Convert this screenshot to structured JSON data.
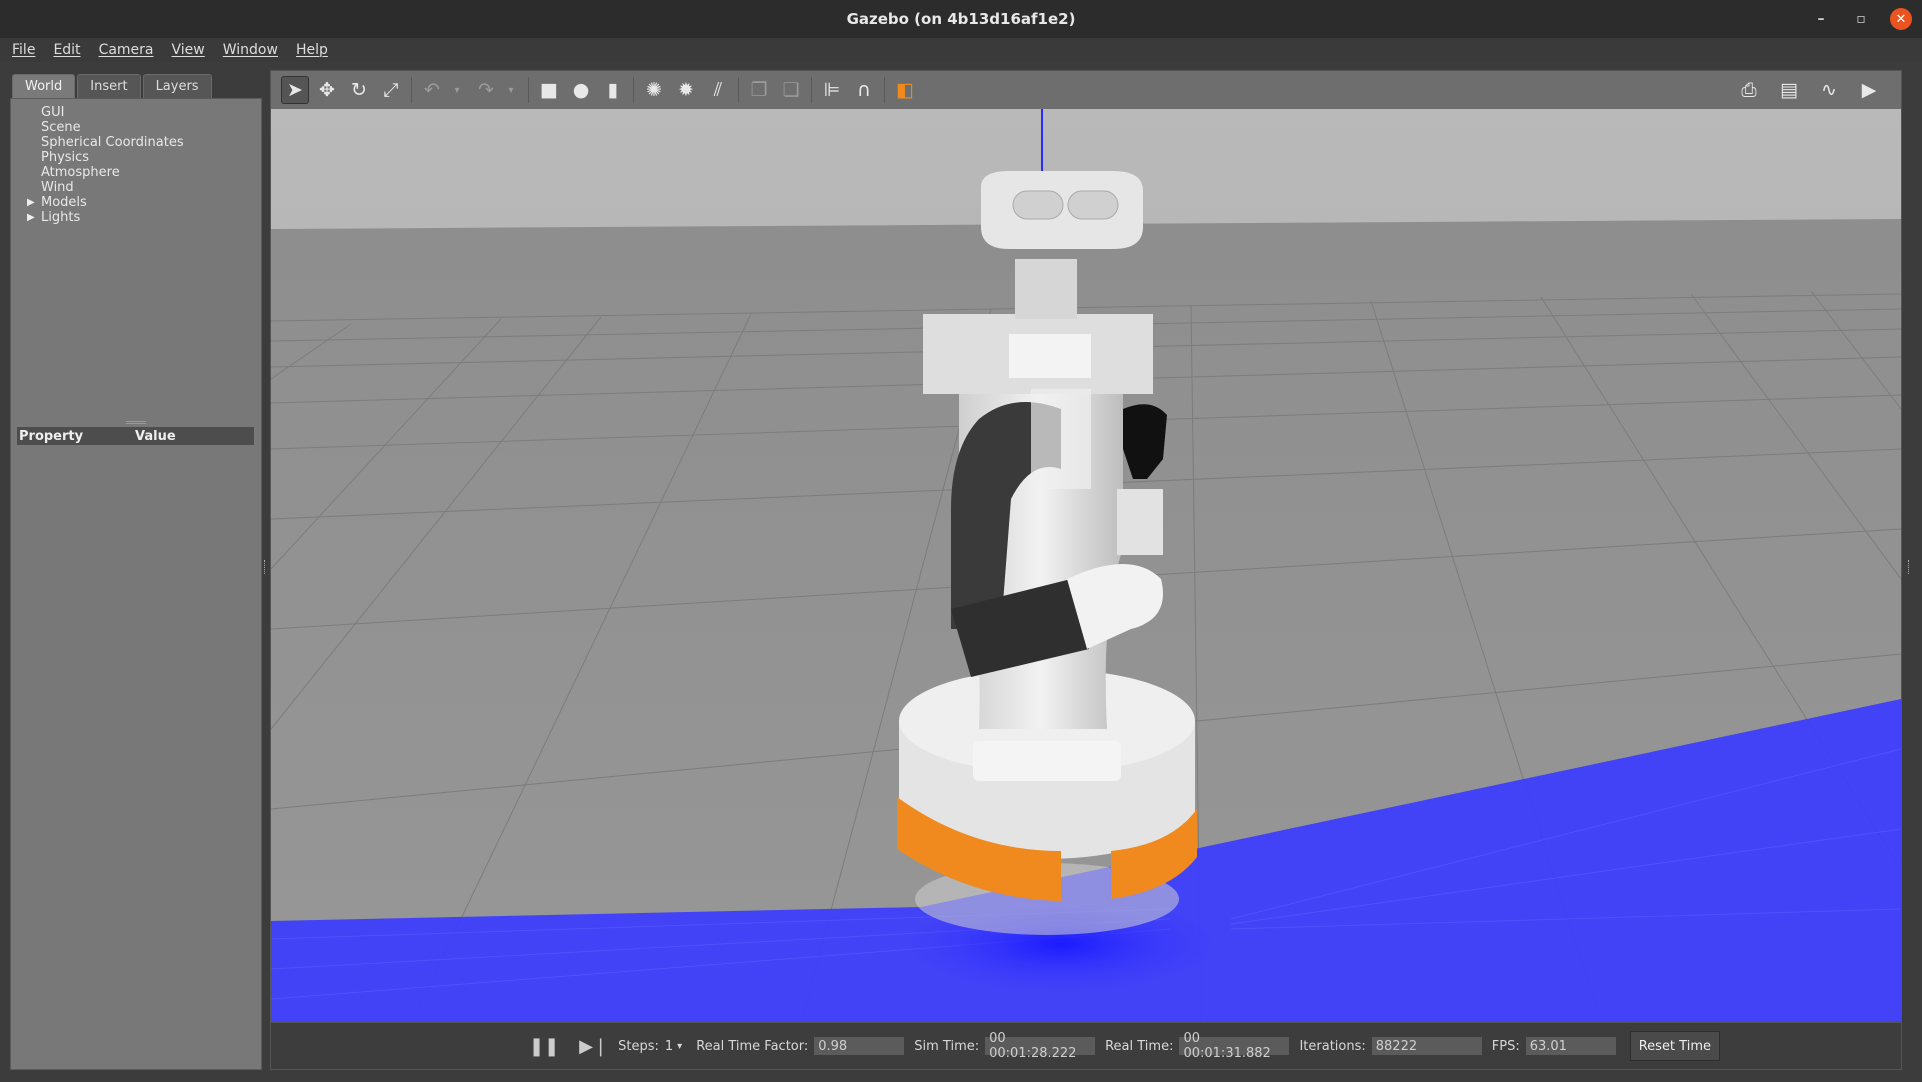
{
  "window": {
    "title": "Gazebo (on 4b13d16af1e2)"
  },
  "menu": [
    "File",
    "Edit",
    "Camera",
    "View",
    "Window",
    "Help"
  ],
  "left_panel": {
    "tabs": [
      "World",
      "Insert",
      "Layers"
    ],
    "active_tab": "World",
    "tree": [
      {
        "label": "GUI",
        "expandable": false
      },
      {
        "label": "Scene",
        "expandable": false
      },
      {
        "label": "Spherical Coordinates",
        "expandable": false
      },
      {
        "label": "Physics",
        "expandable": false
      },
      {
        "label": "Atmosphere",
        "expandable": false
      },
      {
        "label": "Wind",
        "expandable": false
      },
      {
        "label": "Models",
        "expandable": true
      },
      {
        "label": "Lights",
        "expandable": true
      }
    ],
    "property_header": {
      "property": "Property",
      "value": "Value"
    }
  },
  "toolbar": {
    "icons": [
      "select-arrow-icon",
      "translate-icon",
      "rotate-icon",
      "scale-icon",
      "undo-icon",
      "redo-icon",
      "box-icon",
      "sphere-icon",
      "cylinder-icon",
      "point-light-icon",
      "spot-light-icon",
      "directional-light-icon",
      "copy-icon",
      "paste-icon",
      "align-icon",
      "snap-icon",
      "view-angle-icon",
      "screenshot-icon",
      "log-icon",
      "plot-icon",
      "video-record-icon"
    ]
  },
  "bottom": {
    "steps_label": "Steps:",
    "steps_value": "1",
    "rtf_label": "Real Time Factor:",
    "rtf_value": "0.98",
    "sim_time_label": "Sim Time:",
    "sim_time_value": "00 00:01:28.222",
    "real_time_label": "Real Time:",
    "real_time_value": "00 00:01:31.882",
    "iterations_label": "Iterations:",
    "iterations_value": "88222",
    "fps_label": "FPS:",
    "fps_value": "63.01",
    "reset_label": "Reset Time"
  },
  "colors": {
    "accent_close": "#e95420",
    "laser": "#3b3bff",
    "bumper": "#f08a1e"
  }
}
